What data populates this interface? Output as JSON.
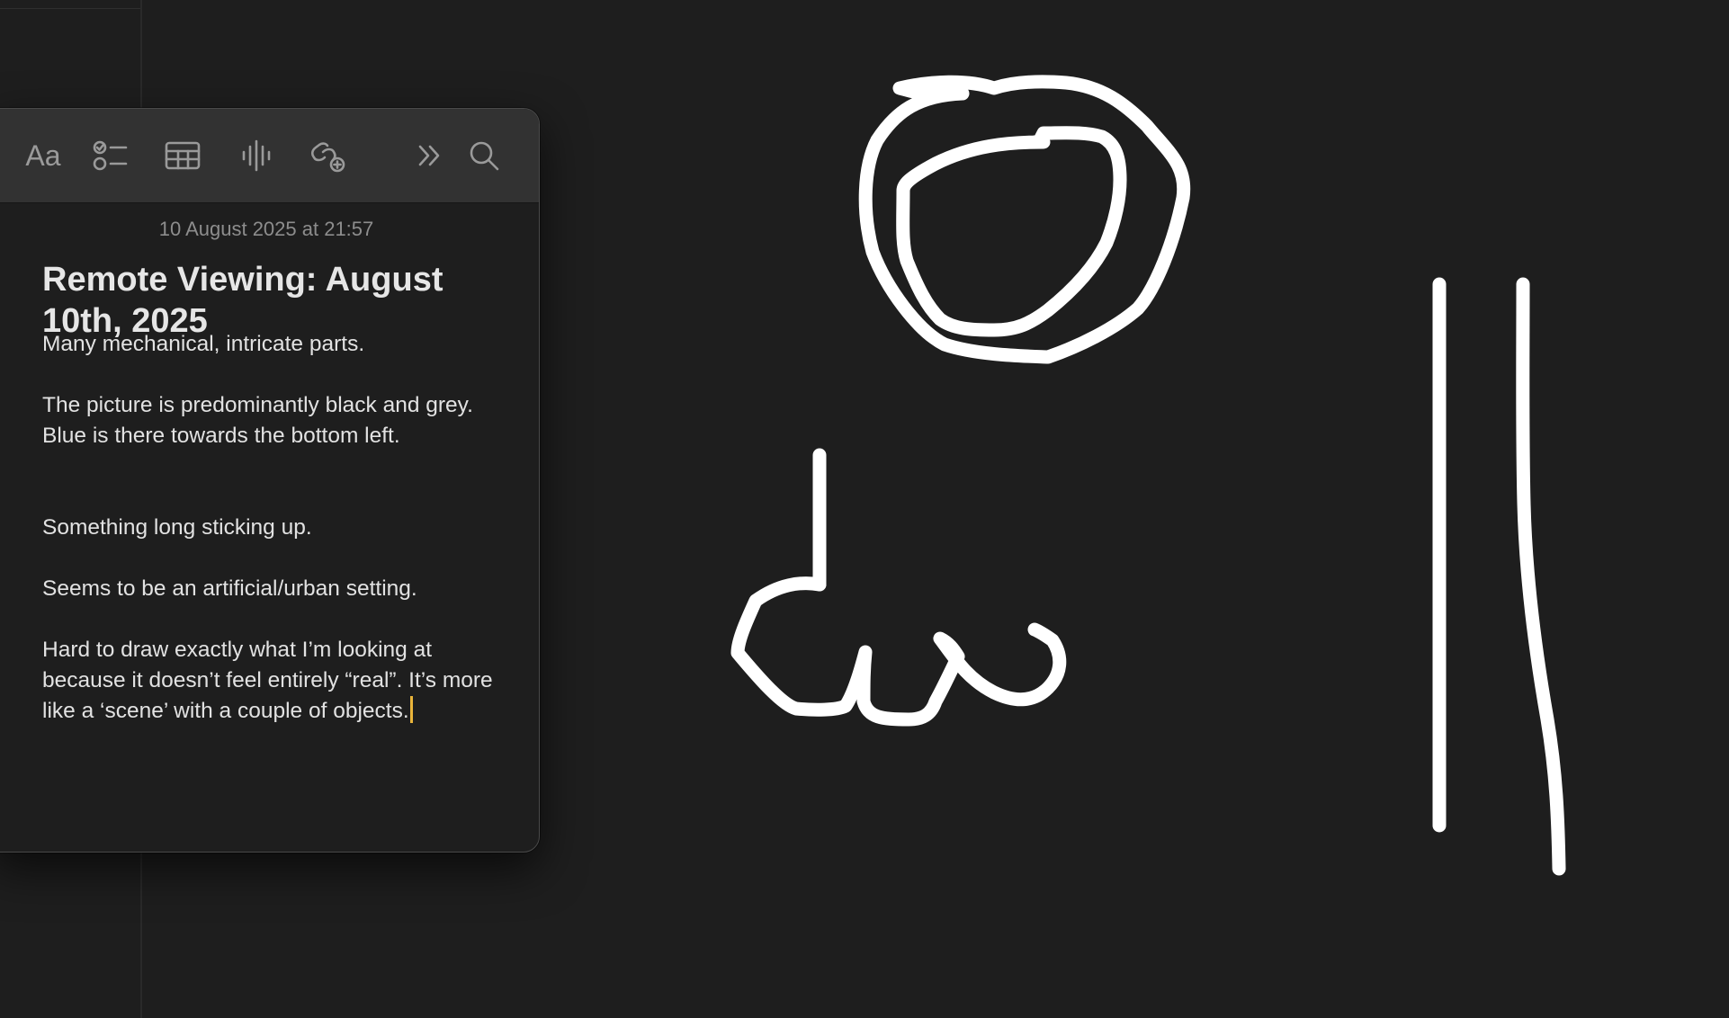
{
  "note": {
    "timestamp": "10 August 2025 at 21:57",
    "title": "Remote Viewing: August 10th, 2025",
    "paragraphs": [
      "Many mechanical, intricate parts.",
      "The picture is predominantly black and grey. Blue is there towards the bottom left.",
      "Something long sticking up.",
      "Seems to be an artificial/urban setting.",
      "Hard to draw exactly what I’m looking at because it doesn’t feel entirely “real”. It’s more like a ‘scene’ with a couple of objects."
    ]
  },
  "toolbar": {
    "format_label": "Aa",
    "icons": {
      "format": "text-format-icon",
      "checklist": "checklist-icon",
      "table": "table-icon",
      "audio": "waveform-icon",
      "link": "link-add-icon",
      "more": "chevron-double-right-icon",
      "search": "search-icon"
    }
  },
  "colors": {
    "background": "#1e1e1e",
    "toolbar": "#323232",
    "text": "#e2e2e2",
    "timestamp": "#8d8d8d",
    "caret": "#e9b43a",
    "stroke": "#ffffff"
  }
}
